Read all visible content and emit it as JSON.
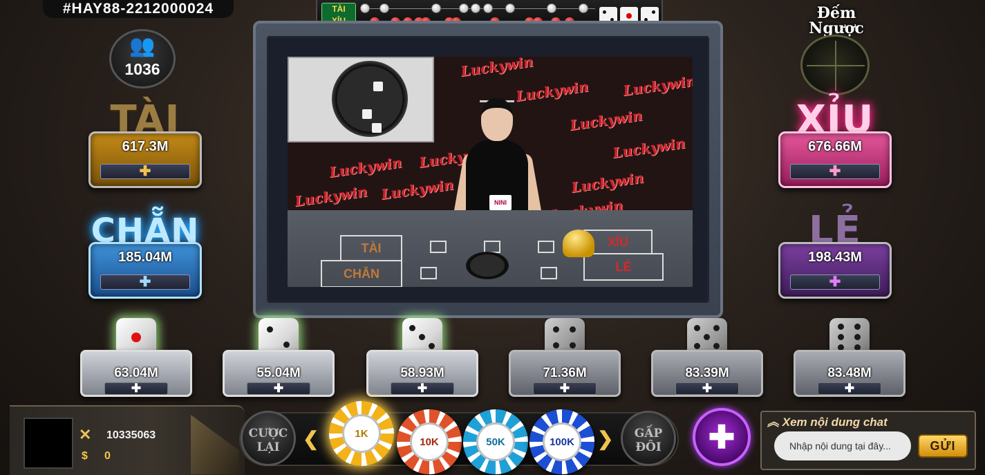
{
  "session": {
    "id": "#HAY88-2212000024"
  },
  "players": {
    "count": "1036",
    "icon": "users-icon"
  },
  "history": {
    "label_top": "TÀI",
    "label_bottom": "XỈU",
    "white_beads": 12,
    "red_beads": 12,
    "last_roll": [
      2,
      1,
      2
    ]
  },
  "countdown": {
    "label": "Đếm Ngược"
  },
  "video": {
    "brand": "Luckywin",
    "dealer_name": "NINI",
    "table_labels": {
      "tai": "TÀI",
      "chan": "CHẴN",
      "xiu": "XỈU",
      "le": "LẺ"
    }
  },
  "bets": {
    "tai": {
      "label": "TÀI",
      "amount": "617.3M"
    },
    "chan": {
      "label": "CHẴN",
      "amount": "185.04M"
    },
    "xiu": {
      "label": "XỈU",
      "amount": "676.66M"
    },
    "le": {
      "label": "LẺ",
      "amount": "198.43M"
    },
    "add_symbol": "✚"
  },
  "dice_bets": [
    {
      "face": 1,
      "amount": "63.04M",
      "lit": true
    },
    {
      "face": 2,
      "amount": "55.04M",
      "lit": true
    },
    {
      "face": 3,
      "amount": "58.93M",
      "lit": true
    },
    {
      "face": 4,
      "amount": "71.36M",
      "lit": false
    },
    {
      "face": 5,
      "amount": "83.39M",
      "lit": false
    },
    {
      "face": 6,
      "amount": "83.48M",
      "lit": false
    }
  ],
  "user": {
    "balance": "10335063",
    "money_symbol": "$",
    "money_value": "0"
  },
  "controls": {
    "rebet_line1": "CƯỢC",
    "rebet_line2": "LẠI",
    "double_line1": "GẤP",
    "double_line2": "ĐÔI",
    "prev_arrow": "❮",
    "next_arrow": "❯",
    "plus_symbol": "✚"
  },
  "chips": [
    {
      "label": "1K",
      "color": "#f2b218",
      "text_color": "#b37a00",
      "selected": true
    },
    {
      "label": "10K",
      "color": "#e0522a",
      "text_color": "#a22a0a",
      "selected": false
    },
    {
      "label": "50K",
      "color": "#1fa1d8",
      "text_color": "#0f6e9a",
      "selected": false
    },
    {
      "label": "100K",
      "color": "#1c4fd3",
      "text_color": "#1536a0",
      "selected": false
    }
  ],
  "chat": {
    "toggle_label": "Xem nội dung chat",
    "input_placeholder": "Nhập nội dung tại đây...",
    "send_label": "GỬI"
  }
}
